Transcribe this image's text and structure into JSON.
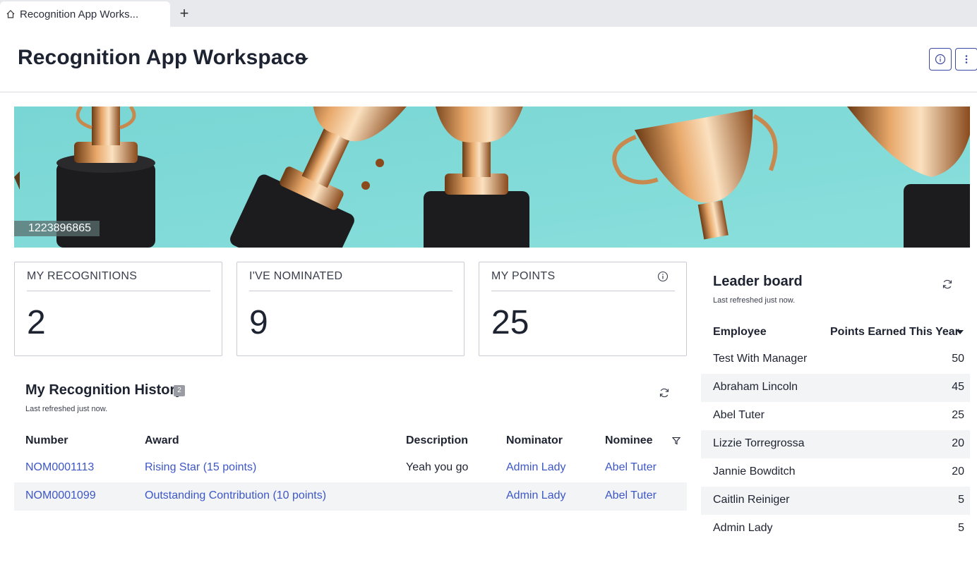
{
  "browser": {
    "tab_title": "Recognition App Works...",
    "new_tab_label": "+"
  },
  "header": {
    "title": "Recognition App Workspace",
    "accent_color": "#3b4aa0"
  },
  "banner": {
    "image_label": "1223896865",
    "background_color": "#7fd9d7"
  },
  "stats": [
    {
      "label": "MY RECOGNITIONS",
      "value": "2"
    },
    {
      "label": "I'VE NOMINATED",
      "value": "9"
    },
    {
      "label": "MY POINTS",
      "value": "25"
    }
  ],
  "history": {
    "title": "My Recognition History",
    "count": "2",
    "last_refreshed": "Last refreshed just now.",
    "columns": [
      "Number",
      "Award",
      "Description",
      "Nominator",
      "Nominee"
    ],
    "rows": [
      {
        "number": "NOM0001113",
        "award": "Rising Star (15 points)",
        "description": "Yeah you go",
        "nominator": "Admin Lady",
        "nominee": "Abel Tuter"
      },
      {
        "number": "NOM0001099",
        "award": "Outstanding Contribution (10 points)",
        "description": "",
        "nominator": "Admin Lady",
        "nominee": "Abel Tuter"
      }
    ]
  },
  "leaderboard": {
    "title": "Leader board",
    "last_refreshed": "Last refreshed just now.",
    "col_employee": "Employee",
    "col_points": "Points Earned This Year",
    "rows": [
      {
        "name": "Test With Manager",
        "points": "50"
      },
      {
        "name": "Abraham Lincoln",
        "points": "45"
      },
      {
        "name": "Abel Tuter",
        "points": "25"
      },
      {
        "name": "Lizzie Torregrossa",
        "points": "20"
      },
      {
        "name": "Jannie Bowditch",
        "points": "20"
      },
      {
        "name": "Caitlin Reiniger",
        "points": "5"
      },
      {
        "name": "Admin Lady",
        "points": "5"
      }
    ]
  },
  "colors": {
    "link": "#3d57c7",
    "alt_row": "#f3f4f6"
  }
}
